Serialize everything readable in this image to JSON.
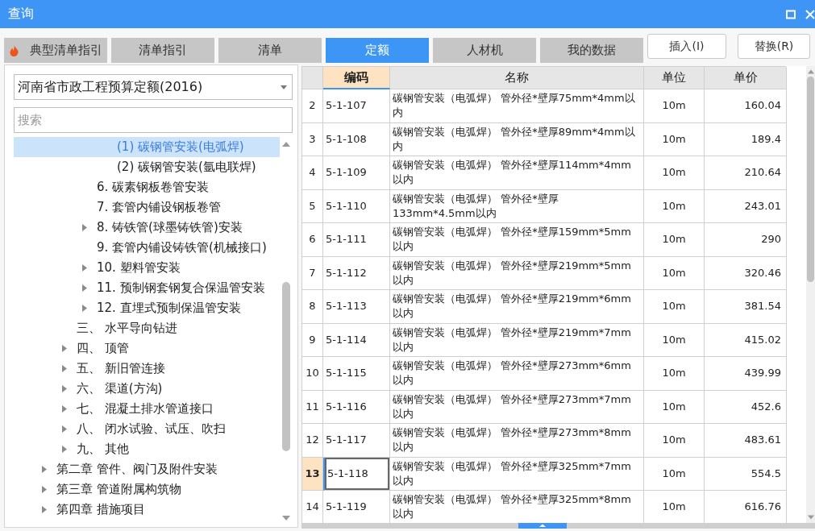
{
  "window": {
    "title": "查询"
  },
  "tabs": [
    {
      "label": "典型清单指引",
      "selected": false,
      "kind": "hot"
    },
    {
      "label": "清单指引",
      "selected": false,
      "kind": "plain"
    },
    {
      "label": "清单",
      "selected": false,
      "kind": "plain"
    },
    {
      "label": "定额",
      "selected": true,
      "kind": "plain"
    },
    {
      "label": "人材机",
      "selected": false,
      "kind": "plain"
    },
    {
      "label": "我的数据",
      "selected": false,
      "kind": "plain"
    }
  ],
  "buttons": [
    "插入(I)",
    "替换(R)"
  ],
  "library_select": {
    "value": "河南省市政工程预算定额(2016)"
  },
  "search": {
    "placeholder": "搜索"
  },
  "tree": {
    "items": [
      {
        "children": [
          {
            "children": [
              {
                "children": [
                  {
                    "children": [
                      {
                        "label": "(1) 碳钢管安装(电弧焊)",
                        "selected": true
                      },
                      {
                        "label": "(2) 碳钢管安装(氩电联焊)",
                        "selected": false
                      }
                    ]
                  },
                  {
                    "label": "6. 碳素钢板卷管安装",
                    "selected": false
                  },
                  {
                    "label": "7. 套管内铺设钢板卷管",
                    "selected": false
                  },
                  {
                    "label": "8. 铸铁管(球墨铸铁管)安装",
                    "expanded": false,
                    "selected": false
                  },
                  {
                    "label": "9. 套管内铺设铸铁管(机械接口)",
                    "selected": false
                  },
                  {
                    "label": "10. 塑料管安装",
                    "expanded": false,
                    "selected": false
                  },
                  {
                    "label": "11. 预制钢套钢复合保温管安装",
                    "expanded": false,
                    "selected": false
                  },
                  {
                    "label": "12. 直埋式预制保温管安装",
                    "expanded": false,
                    "selected": false
                  }
                ]
              },
              {
                "label": "三、 水平导向钻进",
                "selected": false
              },
              {
                "label": "四、 顶管",
                "expanded": false,
                "selected": false
              },
              {
                "label": "五、 新旧管连接",
                "expanded": false,
                "selected": false
              },
              {
                "label": "六、 渠道(方沟)",
                "expanded": false,
                "selected": false
              },
              {
                "label": "七、 混凝土排水管道接口",
                "expanded": false,
                "selected": false
              },
              {
                "label": "八、 闭水试验、试压、吹扫",
                "expanded": false,
                "selected": false
              },
              {
                "label": "九、 其他",
                "expanded": false,
                "selected": false
              }
            ]
          },
          {
            "label": "第二章 管件、阀门及附件安装",
            "expanded": false,
            "selected": false
          },
          {
            "label": "第三章 管道附属构筑物",
            "expanded": false,
            "selected": false
          },
          {
            "label": "第四章 措施项目",
            "expanded": false,
            "selected": false
          }
        ]
      }
    ]
  },
  "table": {
    "columns": [
      {
        "label": "编码",
        "selected": true
      },
      {
        "label": "名称",
        "selected": false
      },
      {
        "label": "单位",
        "selected": false
      },
      {
        "label": "单价",
        "selected": false
      }
    ],
    "rows": [
      {
        "number": "2",
        "code": "5-1-107",
        "name": "碳钢管安装（电弧焊） 管外径*壁厚75mm*4mm以内",
        "unit": "10m",
        "price": "160.04",
        "selected": false
      },
      {
        "number": "3",
        "code": "5-1-108",
        "name": "碳钢管安装（电弧焊） 管外径*壁厚89mm*4mm以内",
        "unit": "10m",
        "price": "189.4",
        "selected": false
      },
      {
        "number": "4",
        "code": "5-1-109",
        "name": "碳钢管安装（电弧焊） 管外径*壁厚114mm*4mm以内",
        "unit": "10m",
        "price": "210.64",
        "selected": false
      },
      {
        "number": "5",
        "code": "5-1-110",
        "name": "碳钢管安装（电弧焊） 管外径*壁厚133mm*4.5mm以内",
        "unit": "10m",
        "price": "243.01",
        "selected": false
      },
      {
        "number": "6",
        "code": "5-1-111",
        "name": "碳钢管安装（电弧焊） 管外径*壁厚159mm*5mm以内",
        "unit": "10m",
        "price": "290",
        "selected": false
      },
      {
        "number": "7",
        "code": "5-1-112",
        "name": "碳钢管安装（电弧焊） 管外径*壁厚219mm*5mm以内",
        "unit": "10m",
        "price": "320.46",
        "selected": false
      },
      {
        "number": "8",
        "code": "5-1-113",
        "name": "碳钢管安装（电弧焊） 管外径*壁厚219mm*6mm以内",
        "unit": "10m",
        "price": "381.54",
        "selected": false
      },
      {
        "number": "9",
        "code": "5-1-114",
        "name": "碳钢管安装（电弧焊） 管外径*壁厚219mm*7mm以内",
        "unit": "10m",
        "price": "415.02",
        "selected": false
      },
      {
        "number": "10",
        "code": "5-1-115",
        "name": "碳钢管安装（电弧焊） 管外径*壁厚273mm*6mm以内",
        "unit": "10m",
        "price": "439.99",
        "selected": false
      },
      {
        "number": "11",
        "code": "5-1-116",
        "name": "碳钢管安装（电弧焊） 管外径*壁厚273mm*7mm以内",
        "unit": "10m",
        "price": "452.6",
        "selected": false
      },
      {
        "number": "12",
        "code": "5-1-117",
        "name": "碳钢管安装（电弧焊） 管外径*壁厚273mm*8mm以内",
        "unit": "10m",
        "price": "483.61",
        "selected": false
      },
      {
        "number": "13",
        "code": "5-1-118",
        "name": "碳钢管安装（电弧焊） 管外径*壁厚325mm*7mm以内",
        "unit": "10m",
        "price": "554.5",
        "selected": true
      },
      {
        "number": "14",
        "code": "5-1-119",
        "name": "碳钢管安装（电弧焊） 管外径*壁厚325mm*8mm以内",
        "unit": "10m",
        "price": "616.76",
        "selected": false
      }
    ]
  }
}
